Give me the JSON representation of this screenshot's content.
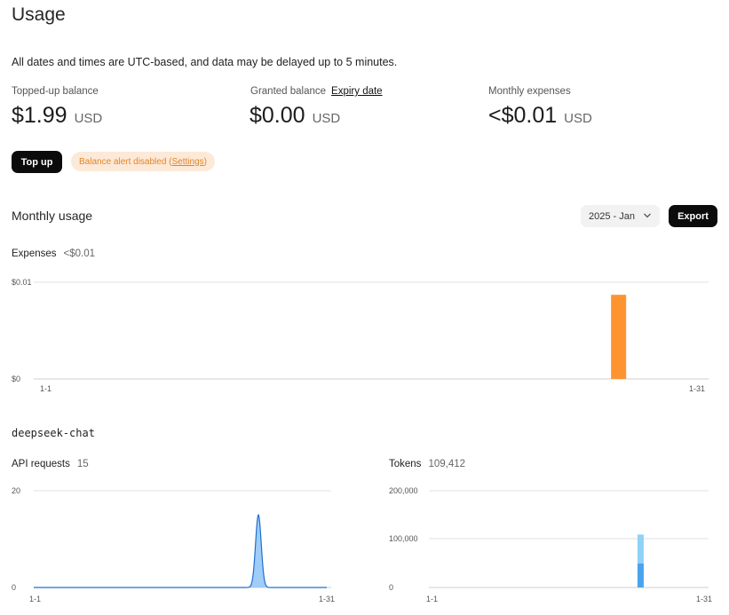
{
  "page": {
    "title": "Usage",
    "note": "All dates and times are UTC-based, and data may be delayed up to 5 minutes."
  },
  "balances": {
    "topped_up": {
      "label": "Topped-up balance",
      "amount": "$1.99",
      "currency": "USD"
    },
    "granted": {
      "label": "Granted balance",
      "link": "Expiry date",
      "amount": "$0.00",
      "currency": "USD"
    },
    "monthly": {
      "label": "Monthly expenses",
      "amount": "<$0.01",
      "currency": "USD"
    }
  },
  "actions": {
    "top_up": "Top up",
    "alert_prefix": "Balance alert disabled (",
    "alert_link": "Settings",
    "alert_suffix": ")"
  },
  "monthly_usage": {
    "title": "Monthly usage",
    "month_selected": "2025 - Jan",
    "export": "Export",
    "expenses_label": "Expenses",
    "expenses_value": "<$0.01"
  },
  "model": {
    "name": "deepseek-chat",
    "requests_label": "API requests",
    "requests_value": "15",
    "tokens_label": "Tokens",
    "tokens_value": "109,412"
  },
  "colors": {
    "expense_bar": "#fd9430",
    "request_line": "#1f6fd1",
    "request_fill": "#8ec4f7",
    "token_light": "#8fd2f6",
    "token_dark": "#4aa3ef",
    "grid": "#e2e2e6"
  },
  "chart_data": [
    {
      "id": "expenses",
      "type": "bar",
      "x_start": "1-1",
      "x_end": "1-31",
      "days": 31,
      "y_ticks": [
        "$0",
        "$0.01"
      ],
      "ylim": [
        0,
        0.01
      ],
      "points": [
        {
          "day": 27,
          "value": 0.0087
        }
      ]
    },
    {
      "id": "api_requests",
      "type": "area",
      "x_start": "1-1",
      "x_end": "1-31",
      "days": 31,
      "y_ticks": [
        "0",
        "20"
      ],
      "ylim": [
        0,
        20
      ],
      "points": [
        {
          "day": 24,
          "value": 15
        }
      ]
    },
    {
      "id": "tokens",
      "type": "bar",
      "x_start": "1-1",
      "x_end": "1-31",
      "days": 31,
      "y_ticks": [
        "0",
        "100,000",
        "200,000"
      ],
      "ylim": [
        0,
        200000
      ],
      "stacked_points": [
        {
          "day": 24,
          "segments": [
            50000,
            59412
          ]
        }
      ]
    }
  ]
}
